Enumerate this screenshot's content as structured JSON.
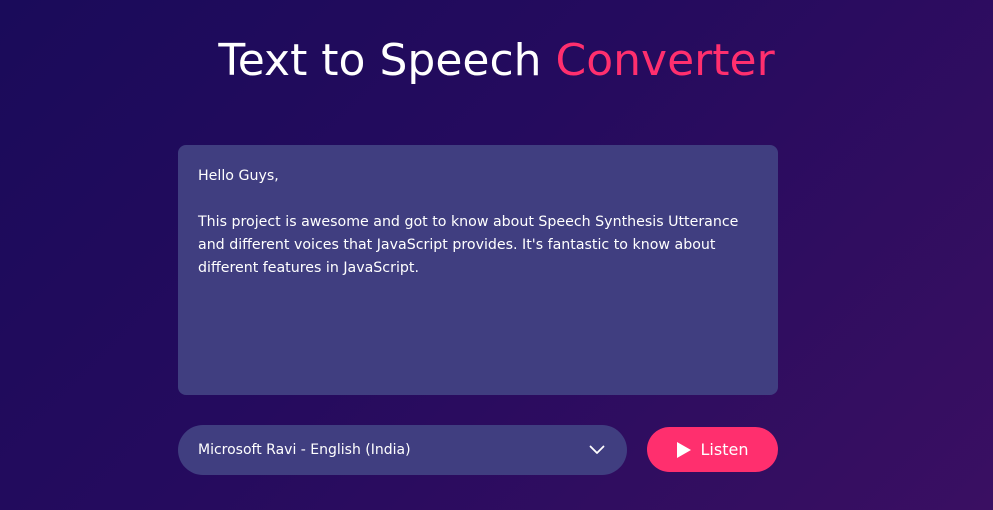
{
  "title": {
    "main": "Text to Speech ",
    "accent": "Converter"
  },
  "textarea": {
    "value": "Hello Guys,\n\nThis project is awesome and got to know about Speech Synthesis Utterance and different voices that JavaScript provides. It's fantastic to know about different features in JavaScript."
  },
  "voice_select": {
    "selected": "Microsoft Ravi - English (India)",
    "icon": "chevron-down-icon"
  },
  "listen_button": {
    "label": "Listen",
    "icon": "play-icon"
  },
  "colors": {
    "accent": "#ff2f6e",
    "panel": "#403e80",
    "background_start": "#1a0b5a",
    "background_end": "#3a0f62"
  }
}
